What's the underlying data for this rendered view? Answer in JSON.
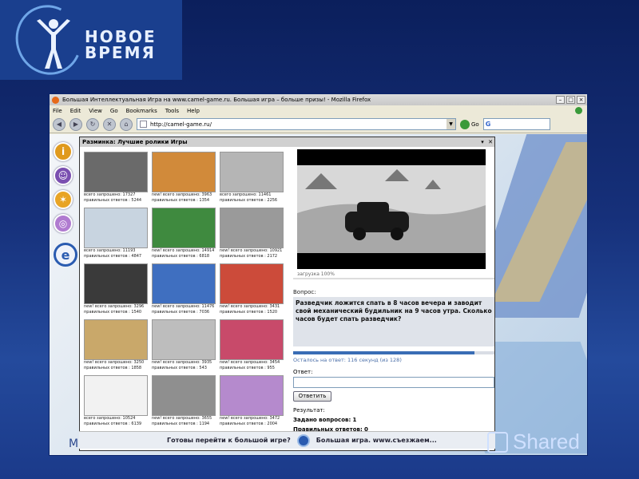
{
  "logo": {
    "line1": "НОВОЕ",
    "line2": "ВРЕМЯ"
  },
  "browser": {
    "title": "Большая Интеллектуальная Игра на www.camel-game.ru. Большая игра – больше призы! - Mozilla Firefox",
    "menu": [
      "File",
      "Edit",
      "View",
      "Go",
      "Bookmarks",
      "Tools",
      "Help"
    ],
    "url": "http://camel-game.ru/",
    "go_label": "Go",
    "search_logo": "G"
  },
  "panel": {
    "title": "Разминка: Лучшие ролики Игры",
    "thumbnails": [
      {
        "top": "всего запрошено: 17327",
        "bottom": "правильных ответов : 5244",
        "color": "#6a6a6a"
      },
      {
        "top": "new! всего запрошено: 3963",
        "bottom": "правильных ответов : 1354",
        "color": "#d18a3a"
      },
      {
        "top": "всего запрошено: 11461",
        "bottom": "правильных ответов : 2256",
        "color": "#b5b5b5"
      },
      {
        "top": "всего запрошено: 11193",
        "bottom": "правильных ответов : 4847",
        "color": "#c8d4e0"
      },
      {
        "top": "new! всего запрошено: 14914",
        "bottom": "правильных ответов : 6818",
        "color": "#3f8a3f"
      },
      {
        "top": "new! всего запрошено: 10921",
        "bottom": "правильных ответов : 2172",
        "color": "#9a9a9a"
      },
      {
        "top": "new! всего запрошено: 3296",
        "bottom": "правильных ответов : 1540",
        "color": "#3a3a3a"
      },
      {
        "top": "new! всего запрошено: 11476",
        "bottom": "правильных ответов : 7036",
        "color": "#3f6fc0"
      },
      {
        "top": "new! всего запрошено: 3431",
        "bottom": "правильных ответов : 1520",
        "color": "#cc4b3a"
      },
      {
        "top": "new! всего запрошено: 3250",
        "bottom": "правильных ответов : 1858",
        "color": "#c9a86a"
      },
      {
        "top": "new! всего запрошено: 3935",
        "bottom": "правильных ответов : 543",
        "color": "#bdbdbd"
      },
      {
        "top": "new! всего запрошено: 3454",
        "bottom": "правильных ответов : 955",
        "color": "#c84a6a"
      },
      {
        "top": "всего запрошено: 10524",
        "bottom": "правильных ответов : 6139",
        "color": "#f2f2f2"
      },
      {
        "top": "new! всего запрошено: 3655",
        "bottom": "правильных ответов : 1194",
        "color": "#8f8f8f"
      },
      {
        "top": "new! всего запрошено: 3472",
        "bottom": "правильных ответов : 2004",
        "color": "#b58acd"
      }
    ],
    "loading": "загрузка 100%",
    "question_label": "Вопрос:",
    "question": "Разведчик ложится спать в 8 часов вечера и заводит свой механический будильник на 9 часов утра. Сколько часов будет спать разведчик?",
    "progress": 0.9,
    "timer": "Осталось на ответ: 116 секунд (из 128)",
    "answer_label": "Ответ:",
    "answer_button": "Ответить",
    "result_label": "Результат:",
    "asked_label": "Задано вопросов:",
    "asked_value": "1",
    "correct_label": "Правильных ответов:",
    "correct_value": "0",
    "bottom_prompt": "Готовы перейти к большой игре?",
    "bottom_link": "Большая игра. www.съезжаем..."
  },
  "footer": {
    "left": "М",
    "brand": "Shared"
  }
}
